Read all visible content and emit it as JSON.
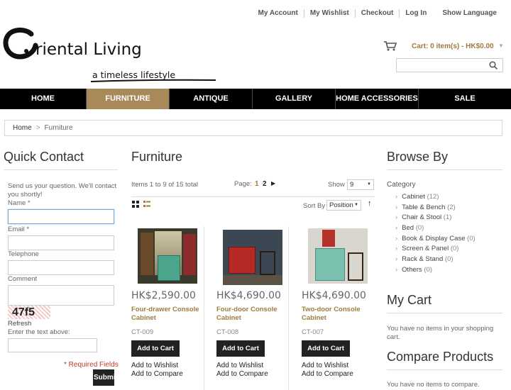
{
  "toplinks": [
    "My Account",
    "My Wishlist",
    "Checkout",
    "Log In"
  ],
  "language": "Show Language",
  "logo": {
    "name": "riental Living",
    "tagline": "a timeless lifestyle"
  },
  "cart": {
    "label": "Cart: 0 item(s) - HK$0.00"
  },
  "nav": [
    {
      "label": "HOME",
      "w": 0
    },
    {
      "label": "FURNITURE"
    },
    {
      "label": "ANTIQUE"
    },
    {
      "label": "GALLERY"
    },
    {
      "label": "HOME ACCESSORIES"
    },
    {
      "label": "SALE"
    }
  ],
  "breadcrumb": {
    "home": "Home",
    "sep": ">",
    "current": "Furniture"
  },
  "quick_contact": {
    "title": "Quick Contact",
    "intro": "Send us your question. We'll contact you shortly!",
    "name_label": "Name *",
    "email_label": "Email *",
    "telephone_label": "Telephone",
    "comment_label": "Comment",
    "captcha": "47f5",
    "refresh": "Refresh",
    "enter_text": "Enter the text above:",
    "required": "* Required Fields",
    "submit": "Submit"
  },
  "catalog": {
    "title": "Furniture",
    "items_total": "Items 1 to 9 of 15 total",
    "page_label": "Page:",
    "pages": [
      "1",
      "2"
    ],
    "show_label": "Show",
    "show_value": "9",
    "sort_label": "Sort By",
    "sort_value": "Position",
    "products": [
      {
        "price": "HK$2,590.00",
        "name": "Four-drawer Console Cabinet",
        "sku": "CT-009",
        "add_to_cart": "Add to Cart",
        "wishlist": "Add to Wishlist",
        "compare": "Add to Compare"
      },
      {
        "price": "HK$4,690.00",
        "name": "Four-door Console Cabinet",
        "sku": "CT-008",
        "add_to_cart": "Add to Cart",
        "wishlist": "Add to Wishlist",
        "compare": "Add to Compare"
      },
      {
        "price": "HK$4,690.00",
        "name": "Two-door Console Cabinet",
        "sku": "CT-007",
        "add_to_cart": "Add to Cart",
        "wishlist": "Add to Wishlist",
        "compare": "Add to Compare"
      }
    ]
  },
  "browse": {
    "title": "Browse By",
    "category_label": "Category",
    "categories": [
      {
        "name": "Cabinet",
        "count": "(12)"
      },
      {
        "name": "Table & Bench",
        "count": "(2)"
      },
      {
        "name": "Chair & Stool",
        "count": "(1)"
      },
      {
        "name": "Bed",
        "count": "(0)"
      },
      {
        "name": "Book & Display Case",
        "count": "(0)"
      },
      {
        "name": "Screen & Panel",
        "count": "(0)"
      },
      {
        "name": "Rack & Stand",
        "count": "(0)"
      },
      {
        "name": "Others",
        "count": "(0)"
      }
    ]
  },
  "my_cart": {
    "title": "My Cart",
    "empty": "You have no items in your shopping cart."
  },
  "compare": {
    "title": "Compare Products",
    "empty": "You have no items to compare."
  }
}
